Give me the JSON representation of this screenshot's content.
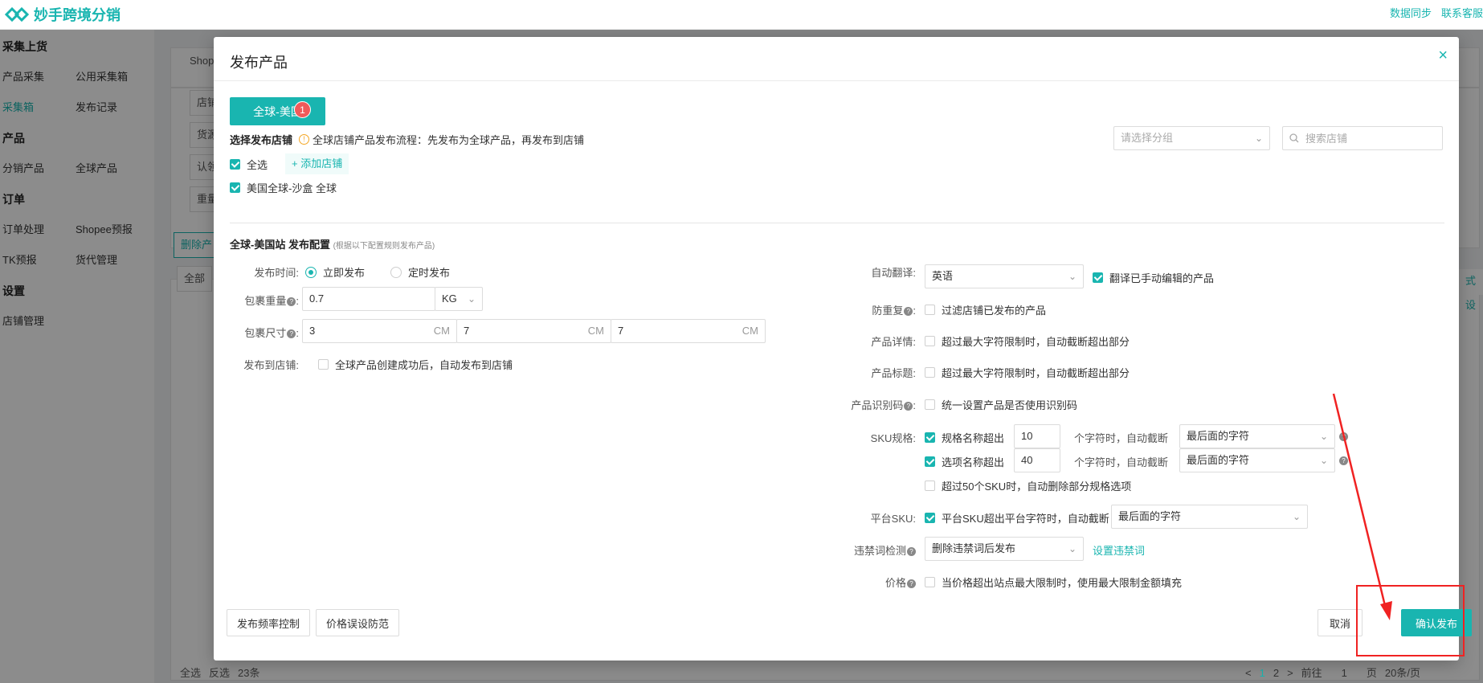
{
  "app": {
    "name": "妙手跨境分销",
    "top_links": [
      "数据同步",
      "联系客服"
    ]
  },
  "sidebar": {
    "sections": [
      {
        "title": "采集上货",
        "items": [
          [
            "产品采集",
            "公用采集箱"
          ],
          [
            "采集箱",
            "发布记录"
          ]
        ],
        "active": "采集箱"
      },
      {
        "title": "产品",
        "items": [
          [
            "分销产品",
            "全球产品"
          ]
        ]
      },
      {
        "title": "订单",
        "items": [
          [
            "订单处理",
            "Shopee预报"
          ],
          [
            "TK预报",
            "货代管理"
          ]
        ]
      },
      {
        "title": "设置",
        "items": [
          [
            "店铺管理"
          ]
        ]
      }
    ]
  },
  "background": {
    "tab_fragment": "Shop",
    "filter_fragments": [
      "店铺",
      "货源",
      "认领",
      "重量"
    ],
    "delete_fragment": "删除产",
    "all_fragment": "全部",
    "right_fragment": "式设",
    "bottom": {
      "select_all": "全选",
      "invert": "反选",
      "count": "23条"
    },
    "pager": {
      "prev_arrow": "<",
      "pages": [
        "1",
        "2"
      ],
      "next_arrow": ">",
      "prev": "前往",
      "page_input": "1",
      "page_unit": "页",
      "page_size": "20条/页"
    }
  },
  "modal": {
    "title": "发布产品",
    "close": "×",
    "region_tab": "全球-美国",
    "region_badge": "1",
    "select_shop_label": "选择发布店铺",
    "flow_info": "全球店铺产品发布流程：先发布为全球产品，再发布到店铺",
    "group_placeholder": "请选择分组",
    "shop_search_placeholder": "搜索店铺",
    "select_all": "全选",
    "add_shop": "+ 添加店铺",
    "shop_item": "美国全球-沙盒 全球",
    "config_title": "全球-美国站 发布配置",
    "config_hint": "(根据以下配置规则发布产品)",
    "left": {
      "publish_time": {
        "label": "发布时间:",
        "opt1": "立即发布",
        "opt2": "定时发布"
      },
      "weight": {
        "label": "包裹重量",
        "value": "0.7",
        "unit": "KG"
      },
      "size": {
        "label": "包裹尺寸",
        "l": "3",
        "w": "7",
        "h": "7",
        "unit": "CM"
      },
      "publish_to_shop": {
        "label": "发布到店铺:",
        "text": "全球产品创建成功后，自动发布到店铺"
      }
    },
    "right": {
      "auto_translate": {
        "label": "自动翻译:",
        "value": "英语",
        "extra": "翻译已手动编辑的产品"
      },
      "anti_dup": {
        "label": "防重复",
        "text": "过滤店铺已发布的产品"
      },
      "detail": {
        "label": "产品详情:",
        "text": "超过最大字符限制时，自动截断超出部分"
      },
      "title": {
        "label": "产品标题:",
        "text": "超过最大字符限制时，自动截断超出部分"
      },
      "idcode": {
        "label": "产品识别码",
        "text": "统一设置产品是否使用识别码"
      },
      "sku": {
        "label": "SKU规格:",
        "name_text": "规格名称超出",
        "name_value": "10",
        "opt_text": "选项名称超出",
        "opt_value": "40",
        "mid_text": "个字符时，自动截断",
        "select_value": "最后面的字符",
        "over50": "超过50个SKU时，自动删除部分规格选项"
      },
      "platform_sku": {
        "label": "平台SKU:",
        "text": "平台SKU超出平台字符时，自动截断",
        "select_value": "最后面的字符"
      },
      "banned": {
        "label": "违禁词检测",
        "value": "删除违禁词后发布",
        "link": "设置违禁词"
      },
      "price": {
        "label": "价格",
        "text": "当价格超出站点最大限制时，使用最大限制金额填充"
      }
    },
    "footer": {
      "freq": "发布频率控制",
      "price_guard": "价格误设防范",
      "cancel": "取消",
      "confirm": "确认发布"
    }
  },
  "colors": {
    "accent": "#19b5b0",
    "badge": "#f05a5a",
    "annotation": "#f02222"
  }
}
